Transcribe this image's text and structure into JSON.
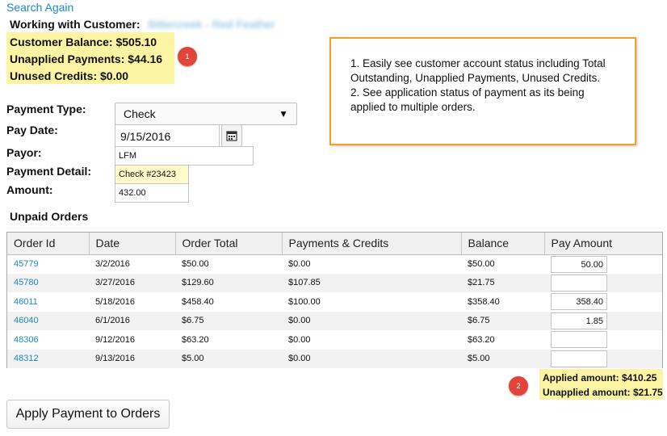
{
  "header": {
    "search_again": "Search Again",
    "working_label": "Working with Customer:",
    "customer_name": "Bittercreek - Red Feather"
  },
  "account_summary": {
    "customer_balance": "Customer Balance: $505.10",
    "unapplied_payments": "Unapplied Payments: $44.16",
    "unused_credits": "Unused Credits: $0.00",
    "badge": "1"
  },
  "callout": {
    "line1": "1.  Easily see customer account status including Total Outstanding, Unapplied Payments, Unused Credits.",
    "line2": "2.  See application status of payment as its being applied to multiple orders."
  },
  "form": {
    "payment_type_label": "Payment Type:",
    "payment_type_value": "Check",
    "pay_date_label": "Pay Date:",
    "pay_date_value": "9/15/2016",
    "payor_label": "Payor:",
    "payor_value": "LFM",
    "payment_detail_label": "Payment Detail:",
    "payment_detail_value": "Check #23423",
    "amount_label": "Amount:",
    "amount_value": "432.00"
  },
  "unpaid_orders": {
    "title": "Unpaid Orders",
    "columns": [
      "Order Id",
      "Date",
      "Order Total",
      "Payments & Credits",
      "Balance",
      "Pay Amount"
    ],
    "rows": [
      {
        "order_id": "45779",
        "date": "3/2/2016",
        "total": "$50.00",
        "payments": "$0.00",
        "balance": "$50.00",
        "pay_amount": "50.00"
      },
      {
        "order_id": "45780",
        "date": "3/27/2016",
        "total": "$129.60",
        "payments": "$107.85",
        "balance": "$21.75",
        "pay_amount": ""
      },
      {
        "order_id": "46011",
        "date": "5/18/2016",
        "total": "$458.40",
        "payments": "$100.00",
        "balance": "$358.40",
        "pay_amount": "358.40"
      },
      {
        "order_id": "46040",
        "date": "6/1/2016",
        "total": "$6.75",
        "payments": "$0.00",
        "balance": "$6.75",
        "pay_amount": "1.85"
      },
      {
        "order_id": "48306",
        "date": "9/12/2016",
        "total": "$63.20",
        "payments": "$0.00",
        "balance": "$63.20",
        "pay_amount": ""
      },
      {
        "order_id": "48312",
        "date": "9/13/2016",
        "total": "$5.00",
        "payments": "$0.00",
        "balance": "$5.00",
        "pay_amount": ""
      }
    ]
  },
  "totals": {
    "applied": "Applied amount: $410.25",
    "unapplied": "Unapplied amount: $21.75",
    "badge": "2"
  },
  "actions": {
    "apply_button": "Apply Payment to Orders"
  },
  "colors": {
    "link": "#1a8bc4",
    "highlight": "#fbf5a3",
    "callout_border": "#f0a129",
    "badge": "#e0443a"
  }
}
